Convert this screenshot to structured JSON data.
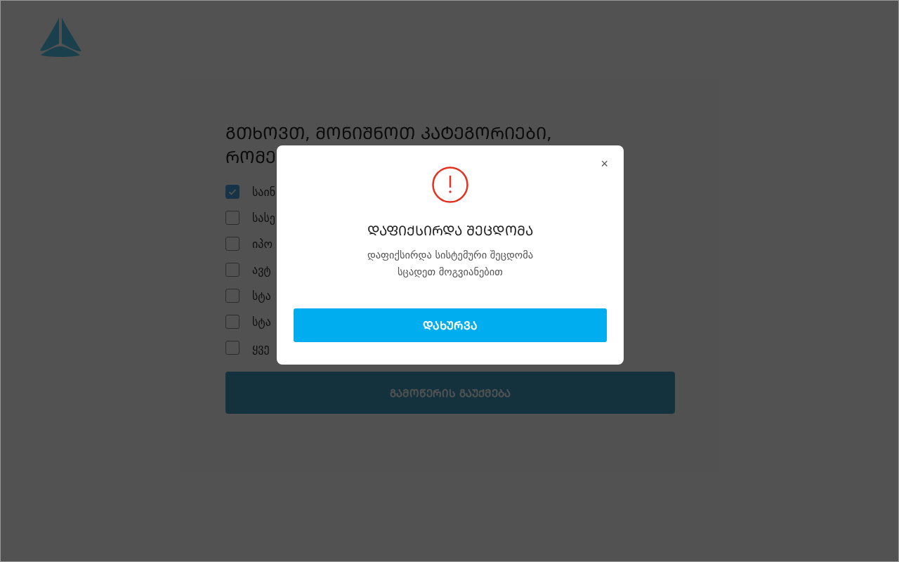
{
  "form": {
    "heading_lines": [
      "ᲒᲗᲮᲝᲕᲗ, ᲛᲝᲜᲘᲨᲜᲝᲗ ᲙᲐᲢᲔᲒᲝᲠᲘᲔᲑᲘ,",
      "ᲠᲝᲛᲔ"
    ],
    "categories": [
      {
        "label": "საინ",
        "checked": true
      },
      {
        "label": "სასე",
        "checked": false
      },
      {
        "label": "იპო",
        "checked": false
      },
      {
        "label": "ავტ",
        "checked": false
      },
      {
        "label": "სტა",
        "checked": false
      },
      {
        "label": "სტა",
        "checked": false
      },
      {
        "label": "ყვე",
        "checked": false
      }
    ],
    "submit": "ᲒᲐᲛᲝᲬᲔᲠᲘᲡ ᲒᲐᲣᲥᲛᲔᲑᲐ"
  },
  "modal": {
    "close": "×",
    "title": "ᲓᲐᲤᲘᲥᲡᲘᲠᲓᲐ ᲨᲔᲪᲓᲝᲛᲐ",
    "message_lines": [
      "დაფიქსირდა სისტემური შეცდომა",
      "სცადეთ მოგვიანებით"
    ],
    "button": "ᲓᲐᲮᲣᲠᲕᲐ"
  }
}
